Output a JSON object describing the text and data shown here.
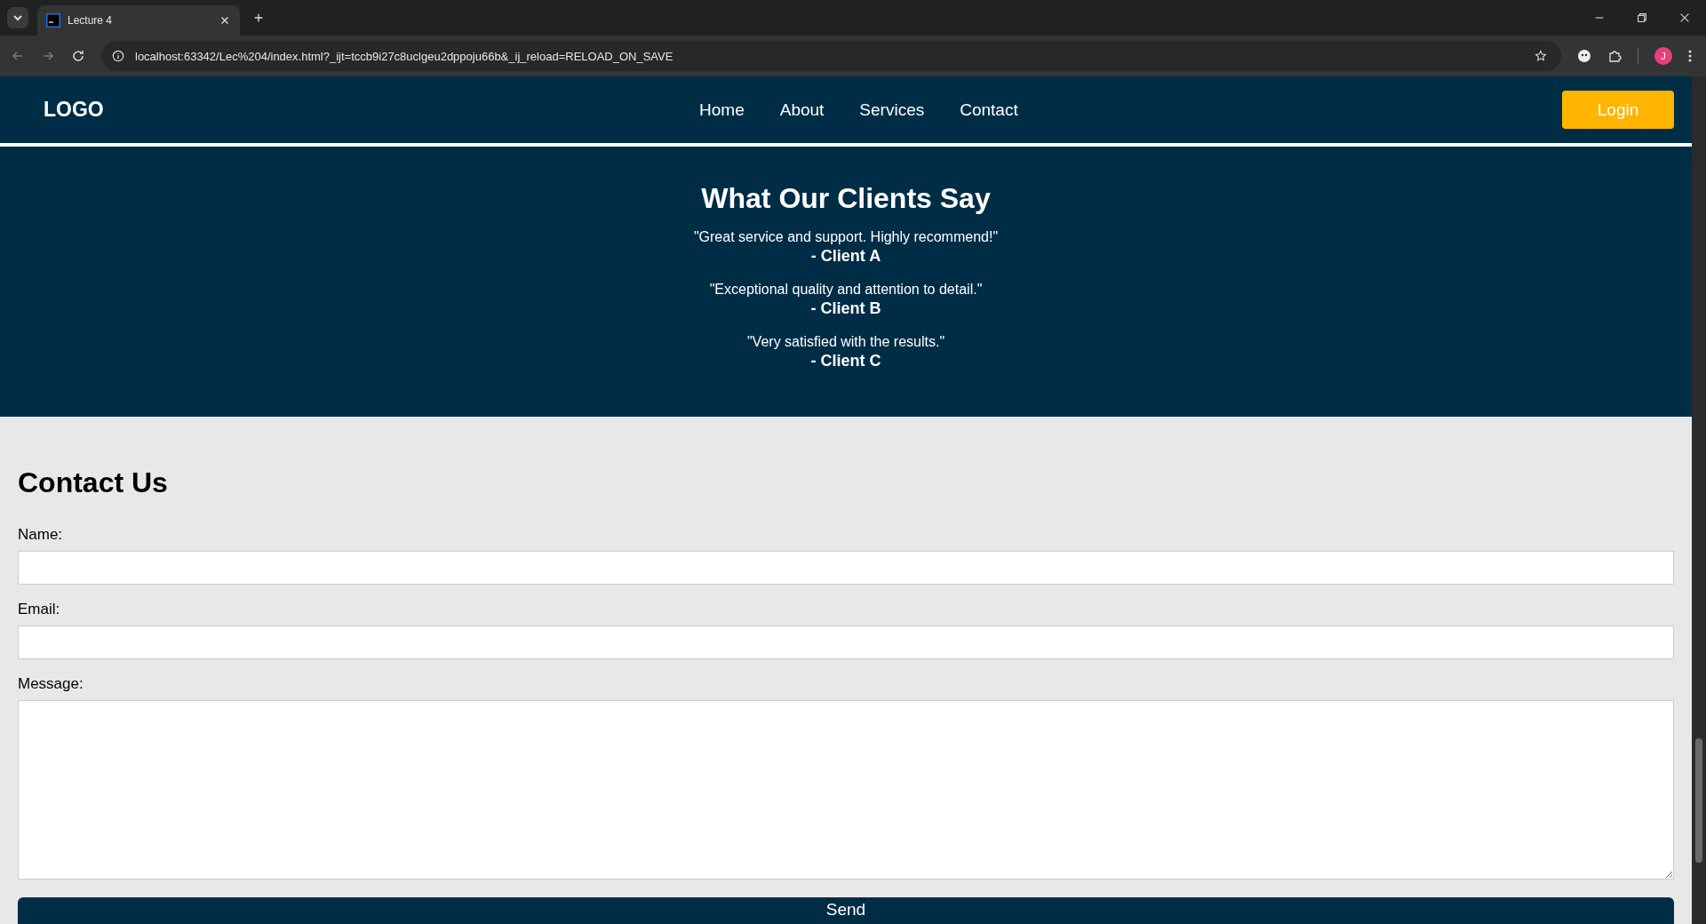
{
  "browser": {
    "tab": {
      "title": "Lecture 4",
      "selected": true
    },
    "url": "localhost:63342/Lec%204/index.html?_ijt=tccb9i27c8uclgeu2dppoju66b&_ij_reload=RELOAD_ON_SAVE",
    "profile": "J"
  },
  "navbar": {
    "logo": "LOGO",
    "links": [
      "Home",
      "About",
      "Services",
      "Contact"
    ],
    "login": "Login"
  },
  "testimonials": {
    "title": "What Our Clients Say",
    "items": [
      {
        "quote": "\"Great service and support. Highly recommend!\"",
        "author": "- Client A"
      },
      {
        "quote": "\"Exceptional quality and attention to detail.\"",
        "author": "- Client B"
      },
      {
        "quote": "\"Very satisfied with the results.\"",
        "author": "- Client C"
      }
    ]
  },
  "contact": {
    "title": "Contact Us",
    "fields": [
      {
        "label": "Name:",
        "kind": "input"
      },
      {
        "label": "Email:",
        "kind": "input"
      },
      {
        "label": "Message:",
        "kind": "textarea"
      }
    ],
    "button": "Send"
  }
}
